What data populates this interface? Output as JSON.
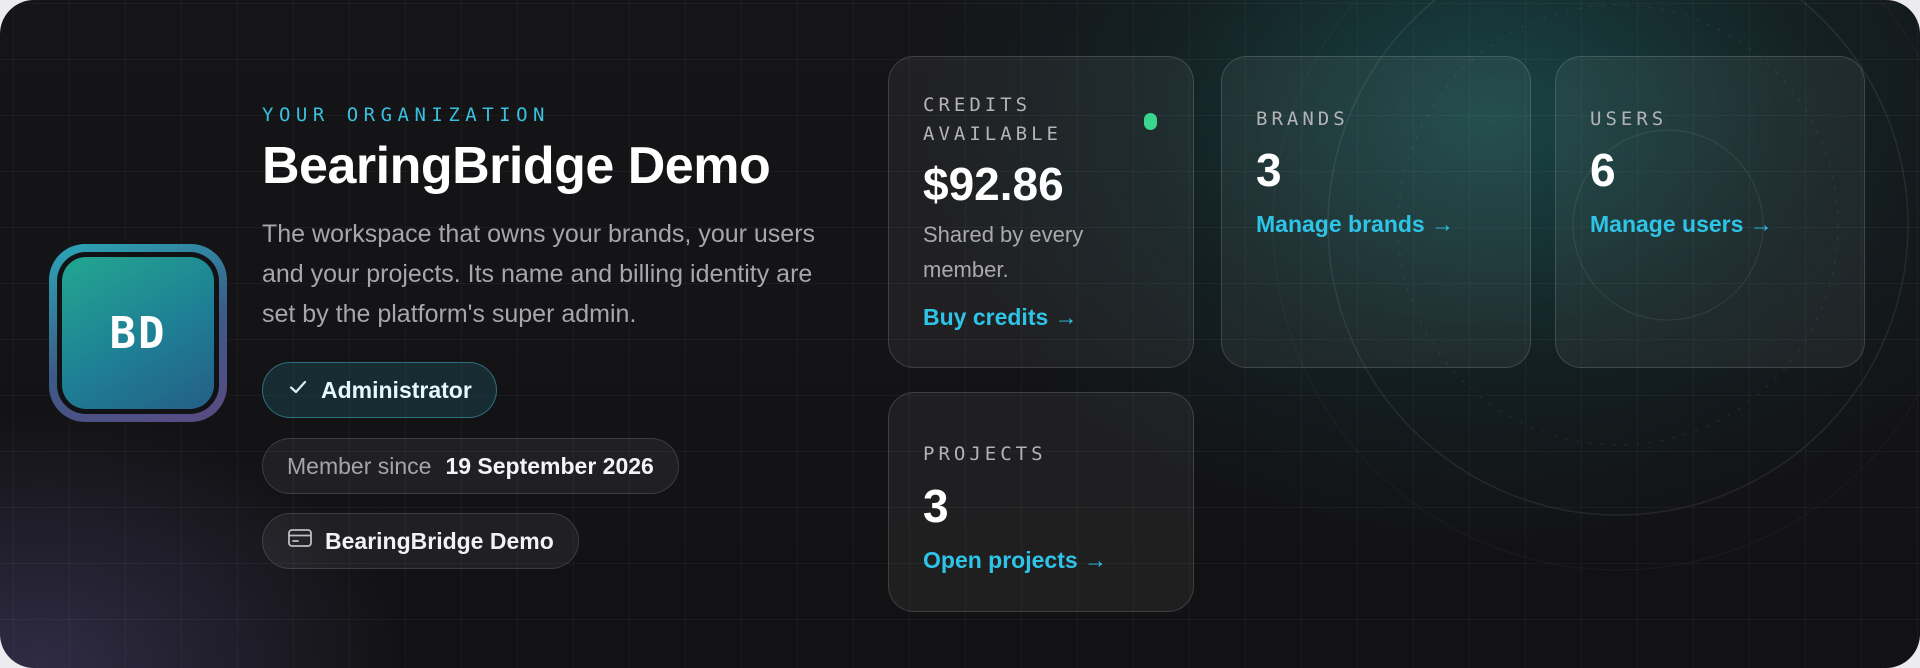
{
  "org": {
    "eyebrow": "YOUR ORGANIZATION",
    "name": "BearingBridge Demo",
    "initials": "BD",
    "description": "The workspace that owns your brands, your users and your projects. Its name and billing identity are set by the platform's super admin.",
    "role_label": "Administrator",
    "member_since_label": "Member since",
    "member_since_value": "19 September 2026",
    "billing_name": "BearingBridge Demo"
  },
  "cards": {
    "credits": {
      "label": "CREDITS AVAILABLE",
      "value": "$92.86",
      "sub": "Shared by every member.",
      "link": "Buy credits →",
      "status_color": "#3ad68d"
    },
    "brands": {
      "label": "BRANDS",
      "value": "3",
      "link": "Manage brands →"
    },
    "users": {
      "label": "USERS",
      "value": "6",
      "link": "Manage users →"
    },
    "projects": {
      "label": "PROJECTS",
      "value": "3",
      "link": "Open projects →"
    }
  },
  "colors": {
    "accent": "#38c0e0",
    "link": "#2ec4e8",
    "status_green": "#3ad68d",
    "panel_bg": "#141416"
  },
  "icons": {
    "role": "check-icon",
    "billing": "credit-card-icon"
  }
}
